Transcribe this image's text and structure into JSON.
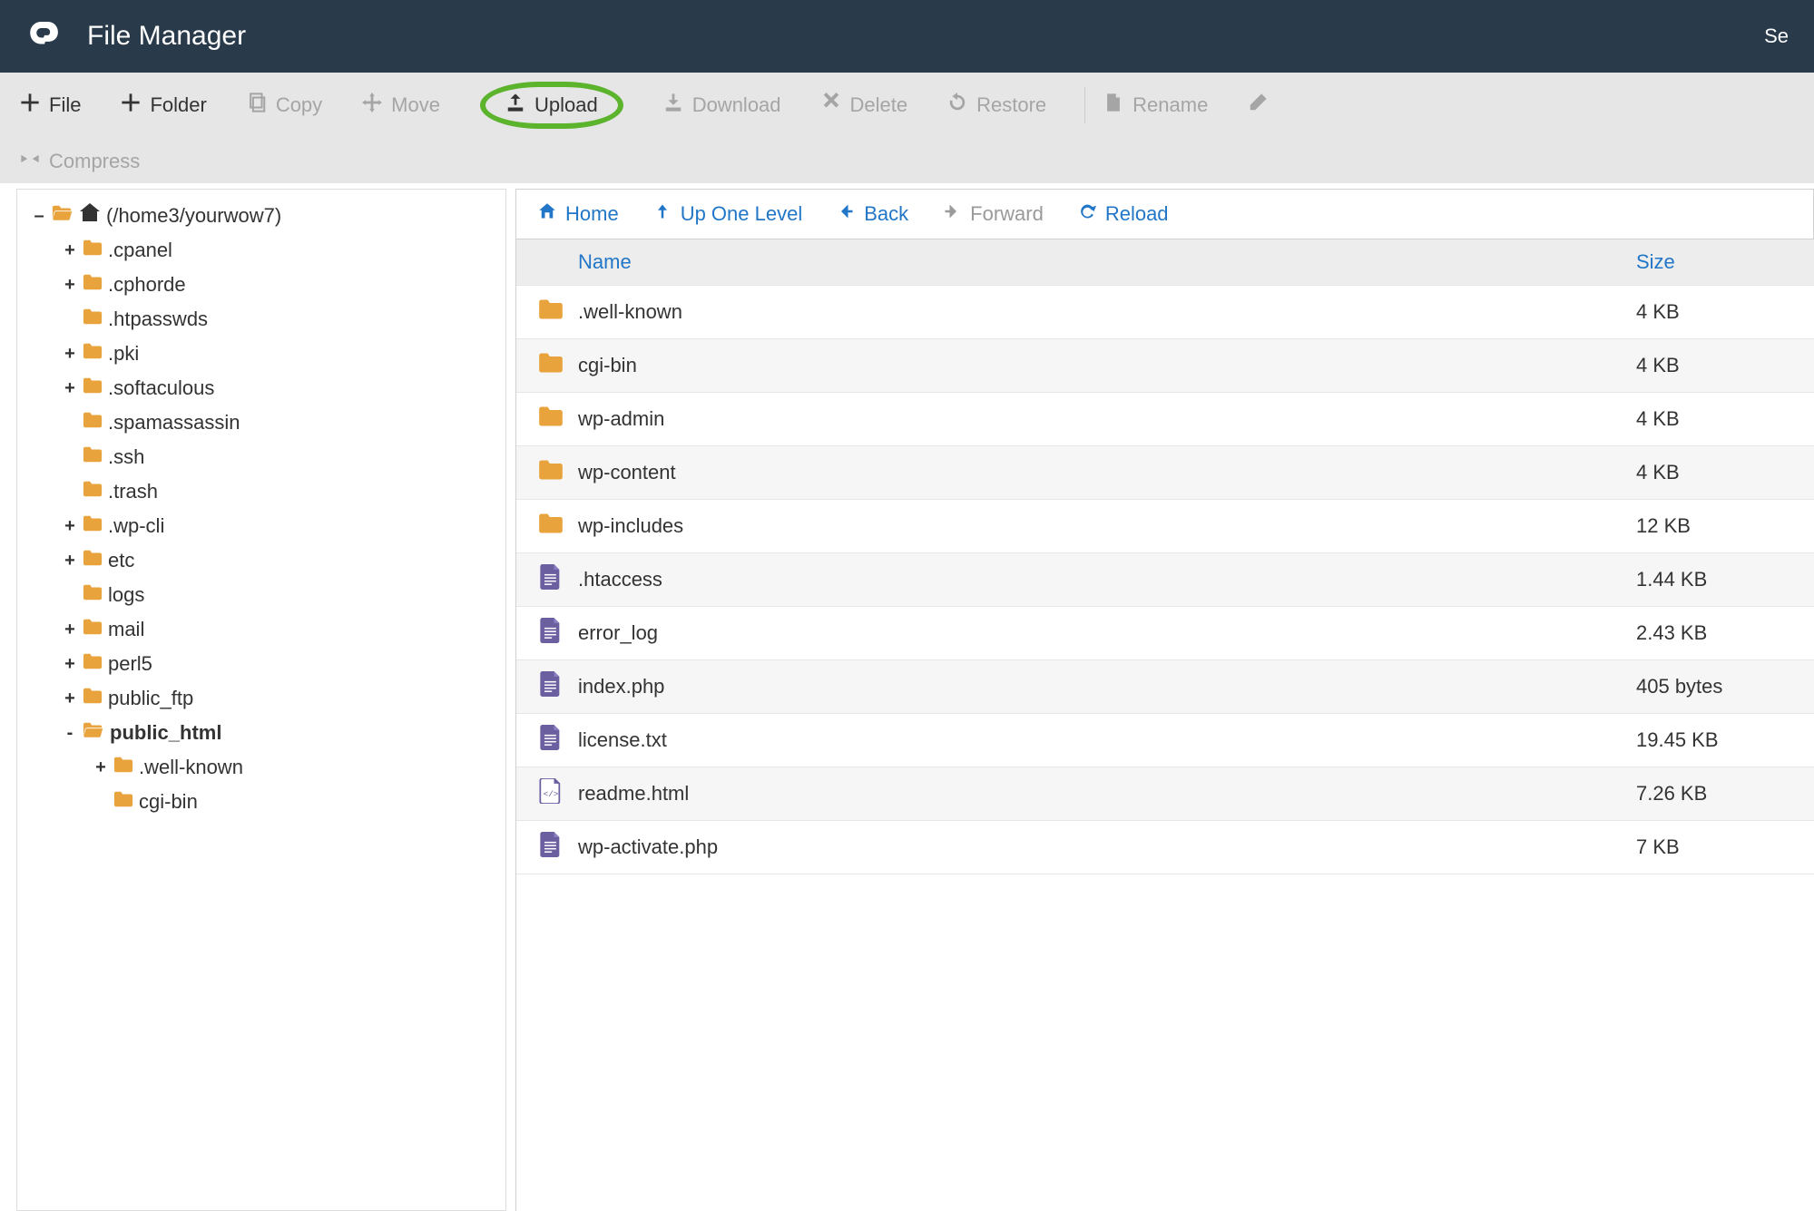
{
  "header": {
    "title": "File Manager",
    "right_text": "Se"
  },
  "toolbar": [
    {
      "id": "file",
      "label": "File",
      "icon": "plus",
      "enabled": true
    },
    {
      "id": "folder",
      "label": "Folder",
      "icon": "plus",
      "enabled": true
    },
    {
      "id": "copy",
      "label": "Copy",
      "icon": "copy",
      "enabled": false
    },
    {
      "id": "move",
      "label": "Move",
      "icon": "move",
      "enabled": false
    },
    {
      "id": "upload",
      "label": "Upload",
      "icon": "upload",
      "enabled": true,
      "highlighted": true
    },
    {
      "id": "download",
      "label": "Download",
      "icon": "download",
      "enabled": false
    },
    {
      "id": "delete",
      "label": "Delete",
      "icon": "delete",
      "enabled": false
    },
    {
      "id": "restore",
      "label": "Restore",
      "icon": "restore",
      "enabled": false
    },
    {
      "id": "separator"
    },
    {
      "id": "rename",
      "label": "Rename",
      "icon": "rename",
      "enabled": false
    },
    {
      "id": "edit",
      "label": "",
      "icon": "edit",
      "enabled": false
    },
    {
      "id": "compress",
      "label": "Compress",
      "icon": "compress",
      "enabled": false,
      "newrow": true
    }
  ],
  "tree": {
    "root_label": "(/home3/yourwow7)",
    "items": [
      {
        "depth": 1,
        "toggle": "+",
        "label": ".cpanel"
      },
      {
        "depth": 1,
        "toggle": "+",
        "label": ".cphorde"
      },
      {
        "depth": 1,
        "toggle": "",
        "label": ".htpasswds"
      },
      {
        "depth": 1,
        "toggle": "+",
        "label": ".pki"
      },
      {
        "depth": 1,
        "toggle": "+",
        "label": ".softaculous"
      },
      {
        "depth": 1,
        "toggle": "",
        "label": ".spamassassin"
      },
      {
        "depth": 1,
        "toggle": "",
        "label": ".ssh"
      },
      {
        "depth": 1,
        "toggle": "",
        "label": ".trash"
      },
      {
        "depth": 1,
        "toggle": "+",
        "label": ".wp-cli"
      },
      {
        "depth": 1,
        "toggle": "+",
        "label": "etc"
      },
      {
        "depth": 1,
        "toggle": "",
        "label": "logs"
      },
      {
        "depth": 1,
        "toggle": "+",
        "label": "mail"
      },
      {
        "depth": 1,
        "toggle": "+",
        "label": "perl5"
      },
      {
        "depth": 1,
        "toggle": "+",
        "label": "public_ftp"
      },
      {
        "depth": 1,
        "toggle": "-",
        "label": "public_html",
        "selected": true
      },
      {
        "depth": 2,
        "toggle": "+",
        "label": ".well-known"
      },
      {
        "depth": 2,
        "toggle": "",
        "label": "cgi-bin"
      }
    ]
  },
  "navbar": [
    {
      "id": "home",
      "label": "Home",
      "icon": "home",
      "enabled": true
    },
    {
      "id": "up",
      "label": "Up One Level",
      "icon": "up",
      "enabled": true
    },
    {
      "id": "back",
      "label": "Back",
      "icon": "back",
      "enabled": true
    },
    {
      "id": "forward",
      "label": "Forward",
      "icon": "forward",
      "enabled": false
    },
    {
      "id": "reload",
      "label": "Reload",
      "icon": "reload",
      "enabled": true
    }
  ],
  "list": {
    "columns": {
      "name": "Name",
      "size": "Size"
    },
    "rows": [
      {
        "type": "folder",
        "name": ".well-known",
        "size": "4 KB"
      },
      {
        "type": "folder",
        "name": "cgi-bin",
        "size": "4 KB"
      },
      {
        "type": "folder",
        "name": "wp-admin",
        "size": "4 KB"
      },
      {
        "type": "folder",
        "name": "wp-content",
        "size": "4 KB"
      },
      {
        "type": "folder",
        "name": "wp-includes",
        "size": "12 KB"
      },
      {
        "type": "file",
        "name": ".htaccess",
        "size": "1.44 KB"
      },
      {
        "type": "file",
        "name": "error_log",
        "size": "2.43 KB"
      },
      {
        "type": "file",
        "name": "index.php",
        "size": "405 bytes"
      },
      {
        "type": "file",
        "name": "license.txt",
        "size": "19.45 KB"
      },
      {
        "type": "html",
        "name": "readme.html",
        "size": "7.26 KB"
      },
      {
        "type": "file",
        "name": "wp-activate.php",
        "size": "7 KB"
      }
    ]
  }
}
